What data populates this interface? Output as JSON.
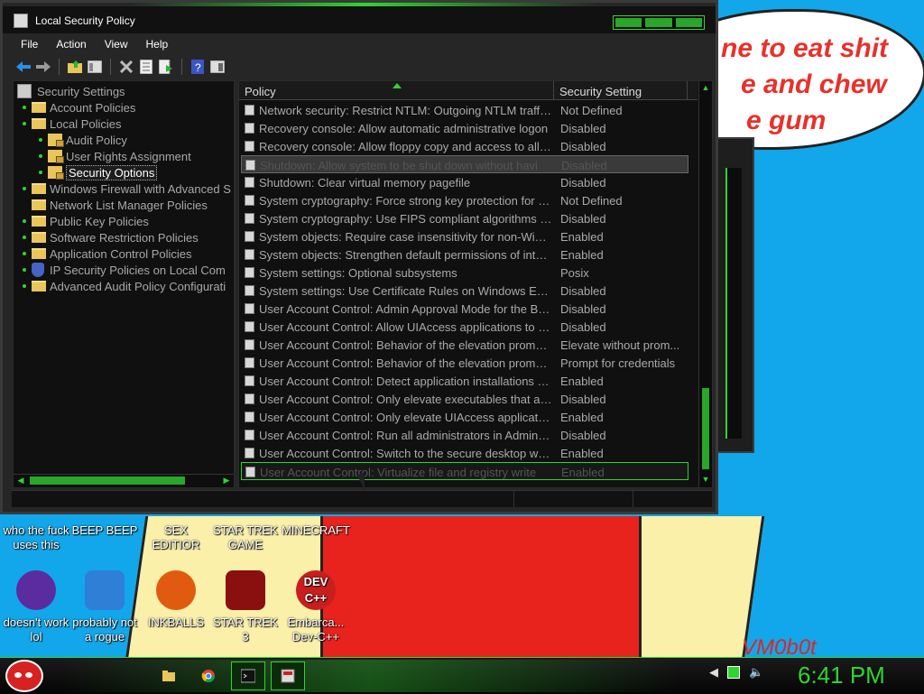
{
  "window": {
    "title": "Local Security Policy",
    "menu": [
      "File",
      "Action",
      "View",
      "Help"
    ]
  },
  "toolbar_icons": [
    "back-arrow-icon",
    "forward-arrow-icon",
    "folder-up-icon",
    "show-hide-tree-icon",
    "delete-icon",
    "properties-icon",
    "export-list-icon",
    "help-icon",
    "console-tree-icon"
  ],
  "tree": [
    {
      "label": "Security Settings",
      "level": 0,
      "icon": "root"
    },
    {
      "label": "Account Policies",
      "level": 1,
      "icon": "folder"
    },
    {
      "label": "Local Policies",
      "level": 1,
      "icon": "folder"
    },
    {
      "label": "Audit Policy",
      "level": 2,
      "icon": "lockf"
    },
    {
      "label": "User Rights Assignment",
      "level": 2,
      "icon": "lockf"
    },
    {
      "label": "Security Options",
      "level": 2,
      "icon": "lockf",
      "selected": true
    },
    {
      "label": "Windows Firewall with Advanced S",
      "level": 1,
      "icon": "folder"
    },
    {
      "label": "Network List Manager Policies",
      "level": 1,
      "icon": "folder"
    },
    {
      "label": "Public Key Policies",
      "level": 1,
      "icon": "folder"
    },
    {
      "label": "Software Restriction Policies",
      "level": 1,
      "icon": "folder"
    },
    {
      "label": "Application Control Policies",
      "level": 1,
      "icon": "folder"
    },
    {
      "label": "IP Security Policies on Local Com",
      "level": 1,
      "icon": "shield"
    },
    {
      "label": "Advanced Audit Policy Configurati",
      "level": 1,
      "icon": "folder"
    }
  ],
  "list": {
    "columns": {
      "policy": "Policy",
      "setting": "Security Setting"
    },
    "rows": [
      {
        "policy": "Network security: Restrict NTLM: Outgoing NTLM traffic to remote servers",
        "setting": "Not Defined"
      },
      {
        "policy": "Recovery console: Allow automatic administrative logon",
        "setting": "Disabled"
      },
      {
        "policy": "Recovery console: Allow floppy copy and access to all drives",
        "setting": "Disabled"
      },
      {
        "policy": "Shutdown: Allow system to be shut down without havi",
        "setting": "Disabled",
        "state": "hl"
      },
      {
        "policy": "Shutdown: Clear virtual memory pagefile",
        "setting": "Disabled"
      },
      {
        "policy": "System cryptography: Force strong key protection for user keys",
        "setting": "Not Defined"
      },
      {
        "policy": "System cryptography: Use FIPS compliant algorithms for encryption",
        "setting": "Disabled"
      },
      {
        "policy": "System objects: Require case insensitivity for non-Windows subsystems",
        "setting": "Enabled"
      },
      {
        "policy": "System objects: Strengthen default permissions of internal system objects",
        "setting": "Enabled"
      },
      {
        "policy": "System settings: Optional subsystems",
        "setting": "Posix"
      },
      {
        "policy": "System settings: Use Certificate Rules on Windows Executables",
        "setting": "Disabled"
      },
      {
        "policy": "User Account Control: Admin Approval Mode for the Built-in Administrator",
        "setting": "Disabled"
      },
      {
        "policy": "User Account Control: Allow UIAccess applications to prompt for elevation",
        "setting": "Disabled"
      },
      {
        "policy": "User Account Control: Behavior of the elevation prompt for administrators",
        "setting": "Elevate without prom..."
      },
      {
        "policy": "User Account Control: Behavior of the elevation prompt for standard users",
        "setting": "Prompt for credentials"
      },
      {
        "policy": "User Account Control: Detect application installations and prompt",
        "setting": "Enabled"
      },
      {
        "policy": "User Account Control: Only elevate executables that are signed",
        "setting": "Disabled"
      },
      {
        "policy": "User Account Control: Only elevate UIAccess applications that are installed",
        "setting": "Enabled"
      },
      {
        "policy": "User Account Control: Run all administrators in Admin Approval Mode",
        "setting": "Disabled"
      },
      {
        "policy": "User Account Control: Switch to the secure desktop when prompting",
        "setting": "Enabled"
      },
      {
        "policy": "User Account Control: Virtualize file and registry write",
        "setting": "Enabled",
        "state": "hl2"
      }
    ]
  },
  "wallpaper": {
    "speech_lines": [
      "ne to eat shit",
      "e and chew",
      "e gum"
    ],
    "signature": "VM0b0t"
  },
  "desktop_icons": [
    {
      "label": "who the fuck uses this",
      "color": "#2a6bd1"
    },
    {
      "label": "BEEP BEEP",
      "color": "#3d85c6"
    },
    {
      "label": "SEX EDITIOR",
      "color": "#6aa84f"
    },
    {
      "label": "STAR TREK GAME",
      "color": "#444444"
    },
    {
      "label": "MINECRAFT",
      "color": "#6aa84f"
    },
    {
      "label": "doesn't work lol",
      "color": "#5a2ca0"
    },
    {
      "label": "probably not a rogue",
      "color": "#2f7fd6"
    },
    {
      "label": "INKBALLS",
      "color": "#e05a10"
    },
    {
      "label": "STAR TREK 3",
      "color": "#8a1010"
    },
    {
      "label": "Embarca... Dev-C++",
      "color": "#c81e1e"
    }
  ],
  "desktop_icon_captions": {
    "devcpp": "DEV C++"
  },
  "taskbar": {
    "clock": "6:41 PM",
    "buttons": [
      "file-explorer-icon",
      "chrome-icon",
      "command-prompt-icon",
      "security-policy-icon"
    ]
  },
  "colors": {
    "accent": "#2fd52f",
    "window_bg": "#101010",
    "desktop": "#12a7ea"
  }
}
